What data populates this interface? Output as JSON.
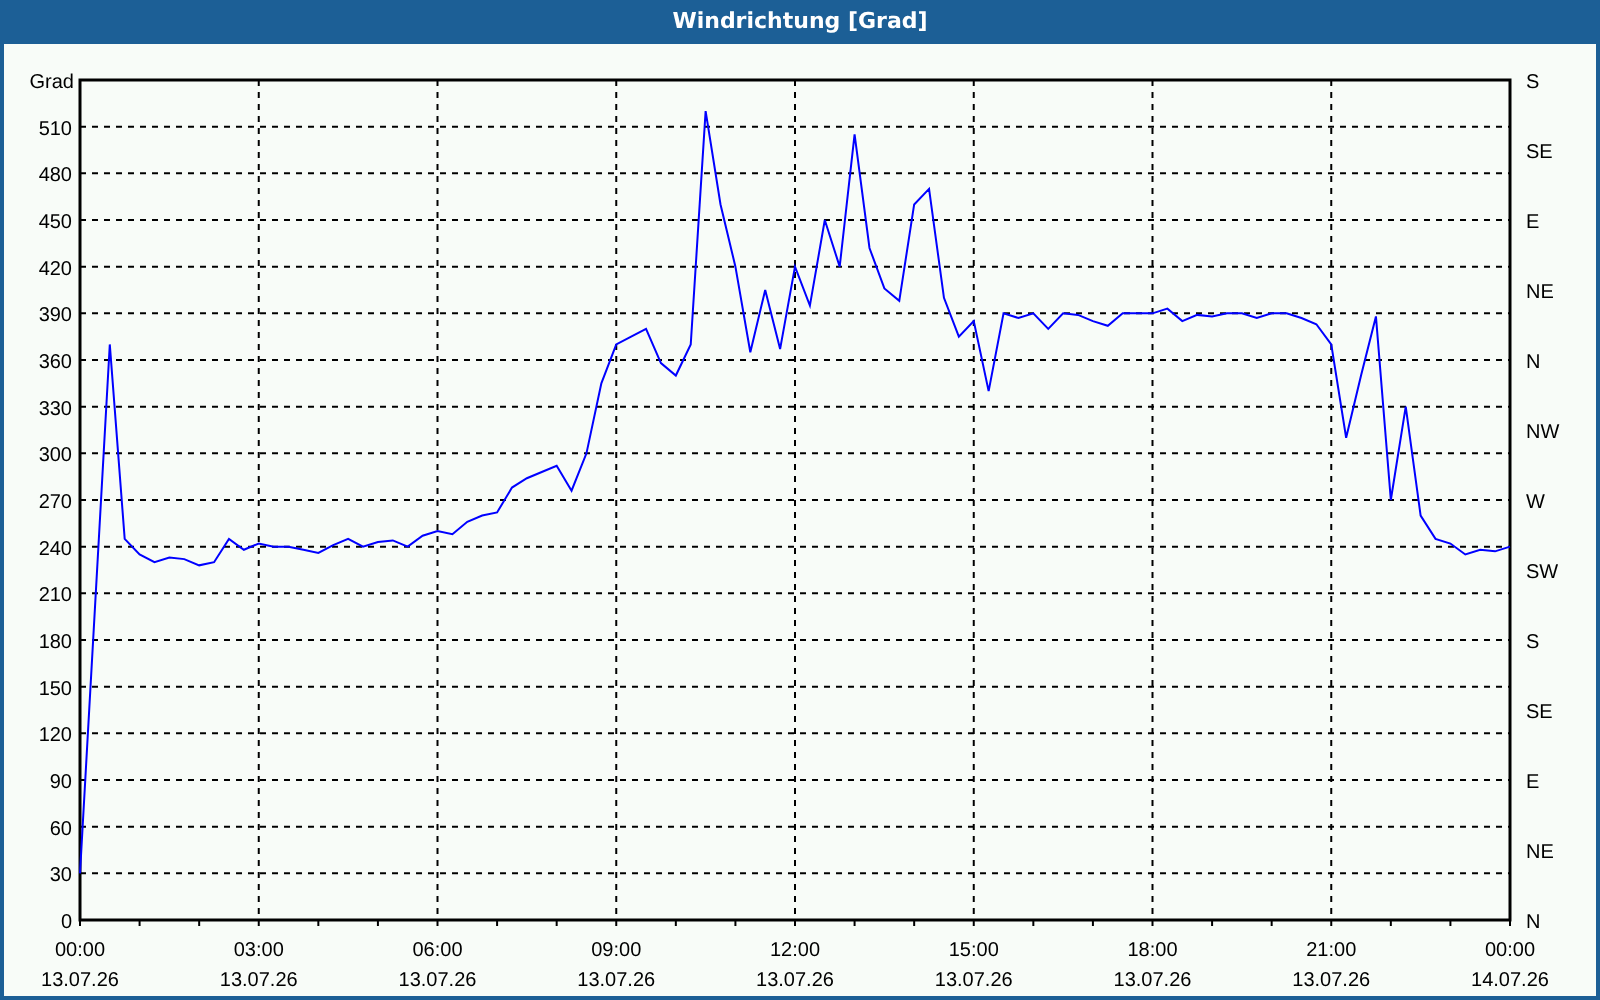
{
  "window": {
    "title": "Windrichtung [Grad]"
  },
  "chart": {
    "chart_data": {
      "type": "line",
      "grid": true,
      "ylabel": "Grad",
      "ylim": [
        0,
        540
      ],
      "yticks": [
        0,
        30,
        60,
        90,
        120,
        150,
        180,
        210,
        240,
        270,
        300,
        330,
        360,
        390,
        420,
        450,
        480,
        510
      ],
      "categories": [
        "00:00\n13.07.26",
        null,
        null,
        null,
        null,
        null,
        null,
        null,
        null,
        null,
        null,
        null,
        "03:00\n13.07.26",
        null,
        null,
        null,
        null,
        null,
        null,
        null,
        null,
        null,
        null,
        null,
        "06:00\n13.07.26",
        null,
        null,
        null,
        null,
        null,
        null,
        null,
        null,
        null,
        null,
        null,
        "09:00\n13.07.26",
        null,
        null,
        null,
        null,
        null,
        null,
        null,
        null,
        null,
        null,
        null,
        "12:00\n13.07.26",
        null,
        null,
        null,
        null,
        null,
        null,
        null,
        null,
        null,
        null,
        null,
        "15:00\n13.07.26",
        null,
        null,
        null,
        null,
        null,
        null,
        null,
        null,
        null,
        null,
        null,
        "18:00\n13.07.26",
        null,
        null,
        null,
        null,
        null,
        null,
        null,
        null,
        null,
        null,
        null,
        "21:00\n13.07.26",
        null,
        null,
        null,
        null,
        null,
        null,
        null,
        null,
        null,
        null,
        null,
        "00:00\n14.07.26"
      ],
      "series": [
        {
          "color": "#0000ff",
          "values": [
            30,
            200,
            370,
            245,
            235,
            230,
            233,
            232,
            228,
            230,
            245,
            238,
            242,
            240,
            240,
            238,
            236,
            241,
            245,
            240,
            243,
            244,
            240,
            247,
            250,
            248,
            256,
            260,
            262,
            278,
            284,
            288,
            292,
            276,
            300,
            345,
            370,
            375,
            380,
            358,
            350,
            370,
            520,
            460,
            420,
            365,
            405,
            367,
            420,
            395,
            450,
            420,
            505,
            432,
            406,
            398,
            460,
            470,
            400,
            375,
            385,
            340,
            390,
            387,
            390,
            380,
            390,
            389,
            385,
            382,
            390,
            390,
            390,
            393,
            385,
            389,
            388,
            390,
            390,
            387,
            390,
            390,
            387,
            383,
            370,
            310,
            350,
            388,
            270,
            330,
            260,
            245,
            242,
            235,
            238,
            237,
            240
          ]
        }
      ]
    },
    "compass_labels": [
      "S",
      "SE",
      "E",
      "NE",
      "N",
      "NW",
      "W",
      "SW",
      "S",
      "SE",
      "E",
      "NE",
      "N"
    ]
  }
}
